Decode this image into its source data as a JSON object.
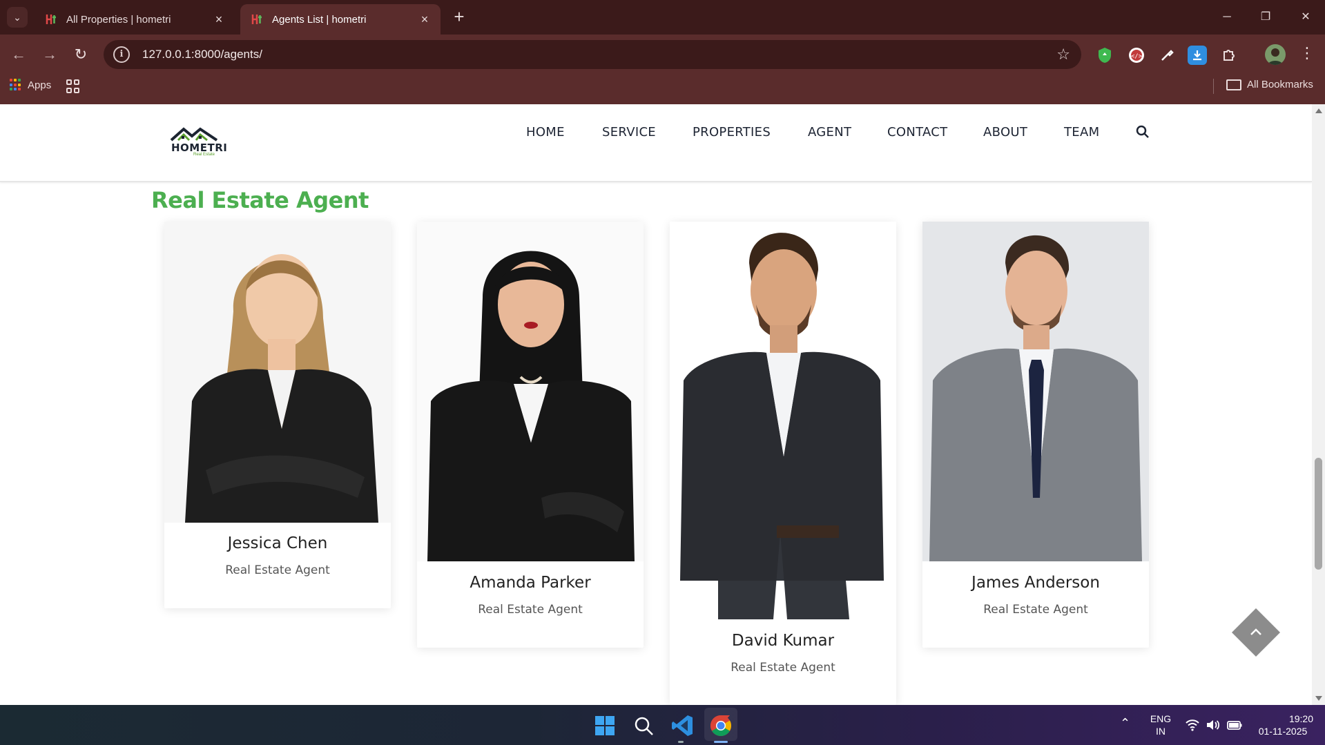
{
  "browser": {
    "tabs": [
      {
        "title": "All Properties | hometri",
        "active": false
      },
      {
        "title": "Agents List | hometri",
        "active": true
      }
    ],
    "url": "127.0.0.1:8000/agents/",
    "bookmarks": {
      "apps_label": "Apps",
      "all_bookmarks_label": "All Bookmarks"
    }
  },
  "site": {
    "logo_text": "HOMETRI",
    "logo_sub": "Real Estate",
    "nav": [
      "HOME",
      "SERVICE",
      "PROPERTIES",
      "AGENT",
      "CONTACT",
      "ABOUT",
      "TEAM"
    ],
    "heading": "Real Estate Agent",
    "heading_color": "#4caf50"
  },
  "agents": [
    {
      "name": "Jessica Chen",
      "role": "Real Estate Agent"
    },
    {
      "name": "Amanda Parker",
      "role": "Real Estate Agent"
    },
    {
      "name": "David Kumar",
      "role": "Real Estate Agent"
    },
    {
      "name": "James Anderson",
      "role": "Real Estate Agent"
    }
  ],
  "taskbar": {
    "lang_top": "ENG",
    "lang_bottom": "IN",
    "time": "19:20",
    "date": "01-11-2025"
  }
}
